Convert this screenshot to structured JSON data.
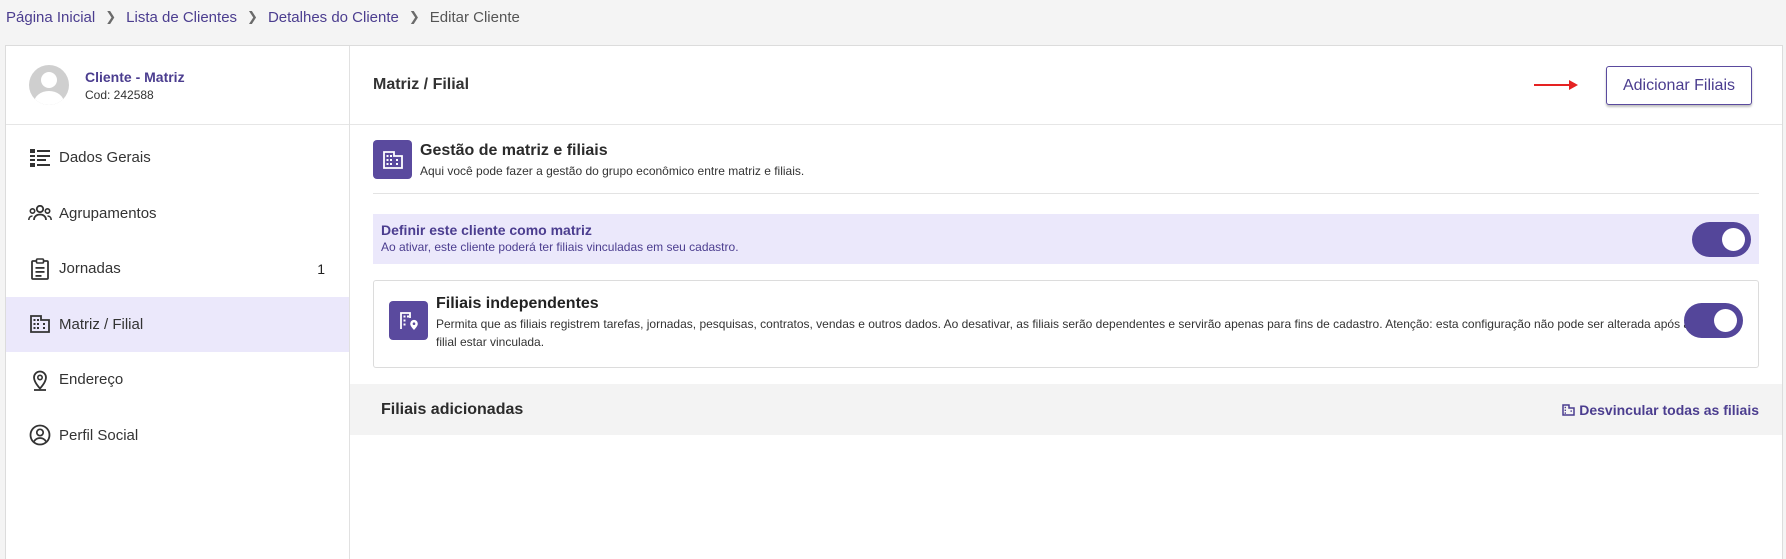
{
  "breadcrumb": {
    "items": [
      "Página Inicial",
      "Lista de Clientes",
      "Detalhes do Cliente"
    ],
    "current": "Editar Cliente"
  },
  "client": {
    "name": "Cliente - Matriz",
    "code": "Cod: 242588"
  },
  "sidebar": {
    "items": [
      {
        "label": "Dados Gerais",
        "icon": "list-icon",
        "count": ""
      },
      {
        "label": "Agrupamentos",
        "icon": "groups-icon",
        "count": ""
      },
      {
        "label": "Jornadas",
        "icon": "clipboard-icon",
        "count": "1"
      },
      {
        "label": "Matriz / Filial",
        "icon": "building-icon",
        "count": "",
        "active": true
      },
      {
        "label": "Endereço",
        "icon": "location-pin-icon",
        "count": ""
      },
      {
        "label": "Perfil Social",
        "icon": "user-circle-icon",
        "count": ""
      }
    ]
  },
  "main": {
    "title": "Matriz / Filial",
    "add_button": "Adicionar Filiais",
    "section": {
      "title": "Gestão de matriz e filiais",
      "subtitle": "Aqui você pode fazer a gestão do grupo econômico entre matriz e filiais."
    },
    "matrix": {
      "title": "Definir este cliente como matriz",
      "subtitle": "Ao ativar, este cliente poderá ter filiais vinculadas em seu cadastro.",
      "enabled": true
    },
    "independent": {
      "title": "Filiais independentes",
      "description": "Permita que as filiais registrem tarefas, jornadas, pesquisas, contratos, vendas e outros dados. Ao desativar, as filiais serão dependentes e servirão apenas para fins de cadastro. Atenção: esta configuração não pode ser alterada após a filial estar vinculada.",
      "enabled": true
    },
    "filiais": {
      "title": "Filiais adicionadas",
      "unlink_label": "Desvincular todas as filiais"
    }
  },
  "colors": {
    "accent": "#4b3d8f",
    "toggle": "#54469a",
    "highlight": "#ebe8fb",
    "arrow": "#e52222"
  }
}
